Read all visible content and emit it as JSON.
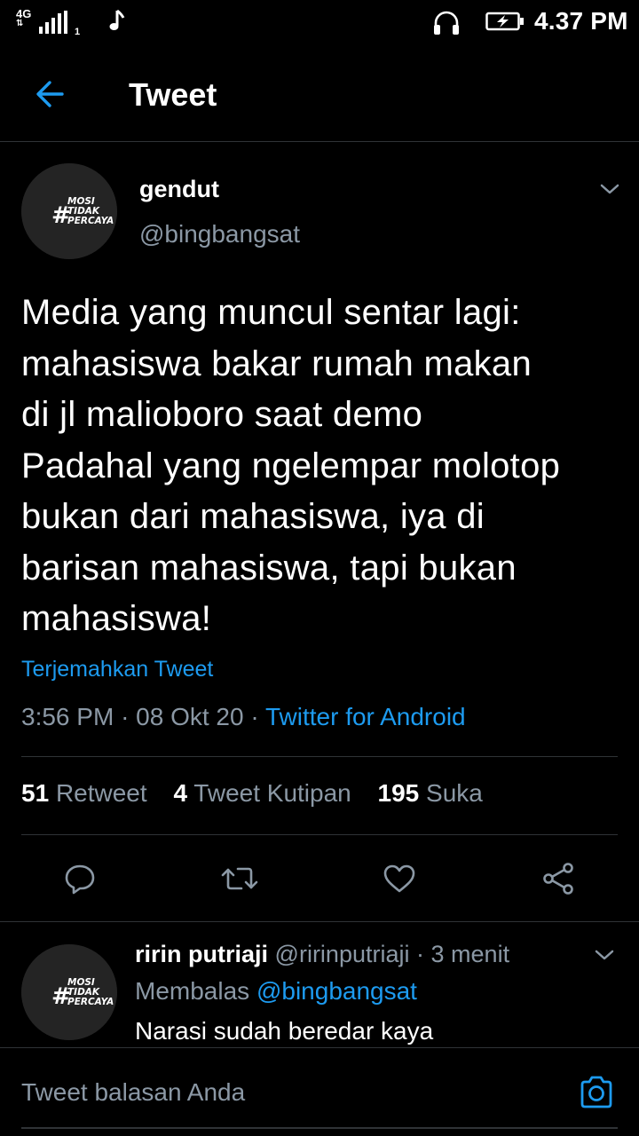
{
  "status_bar": {
    "network": "4G",
    "sim_index": "1",
    "time": "4.37 PM",
    "icons": [
      "signal-icon",
      "music-note-icon",
      "headphones-icon",
      "battery-charging-icon"
    ]
  },
  "header": {
    "title": "Tweet",
    "back_icon": "arrow-left-icon"
  },
  "avatar_badge": {
    "hash": "#",
    "line1": "MOSI",
    "line2": "TIDAK",
    "line3": "PERCAYA"
  },
  "tweet": {
    "author_name": "gendut",
    "author_handle": "@bingbangsat",
    "text_lines": [
      "Media yang muncul sentar lagi:",
      "mahasiswa  bakar rumah makan",
      "di jl malioboro saat demo",
      "Padahal yang ngelempar molotop",
      "bukan dari mahasiswa, iya di",
      "barisan mahasiswa, tapi bukan",
      "mahasiswa!"
    ],
    "translate_label": "Terjemahkan Tweet",
    "time": "3:56 PM",
    "date": "08 Okt 20",
    "separator": "·",
    "client": "Twitter for Android",
    "stats": {
      "retweets_count": "51",
      "retweets_label": "Retweet",
      "quotes_count": "4",
      "quotes_label": "Tweet Kutipan",
      "likes_count": "195",
      "likes_label": "Suka"
    },
    "actions": [
      "reply-icon",
      "retweet-icon",
      "like-icon",
      "share-icon"
    ]
  },
  "reply": {
    "author_name": "ririn putriaji",
    "author_handle": "@ririnputriaji",
    "separator": "·",
    "time_ago": "3 menit",
    "replying_label": "Membalas",
    "replying_to": "@bingbangsat",
    "text": "Narasi sudah beredar kaya"
  },
  "compose": {
    "placeholder": "Tweet balasan Anda",
    "camera_icon": "camera-icon"
  },
  "colors": {
    "background": "#000000",
    "accent": "#1d9bf0",
    "secondary_text": "#8b98a5",
    "divider": "#2f3336"
  }
}
